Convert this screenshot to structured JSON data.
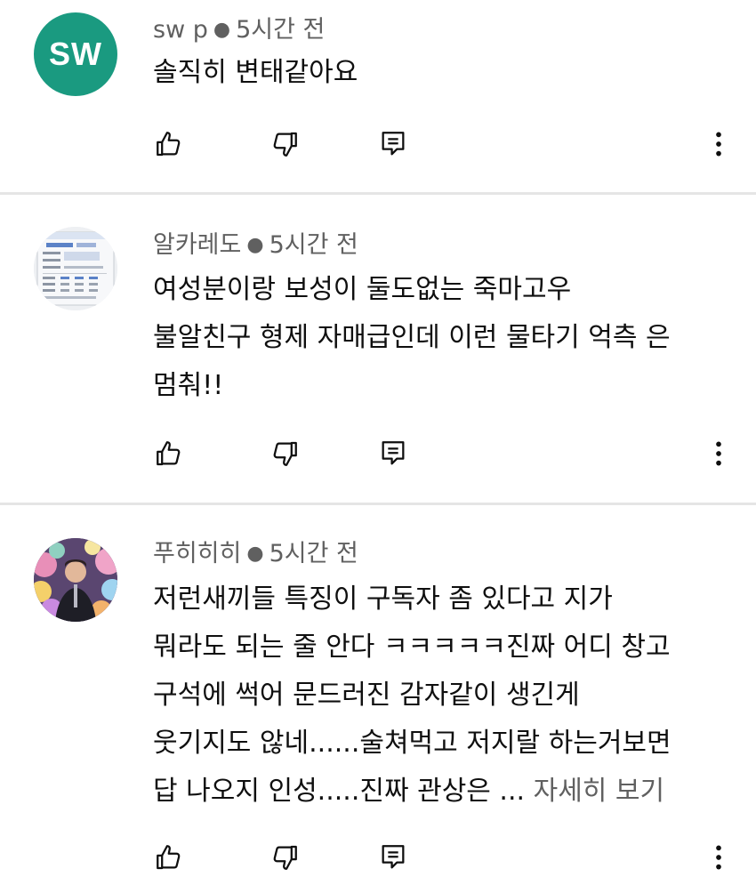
{
  "comments": [
    {
      "author": "sw p",
      "time": "5시간 전",
      "avatar_initials": "SW",
      "avatar_color": "#1a9a80",
      "lines": [
        "솔직히 변태같아요"
      ],
      "read_more": ""
    },
    {
      "author": "알카레도",
      "time": "5시간 전",
      "avatar_kind": "screenshot-thumbnail",
      "lines": [
        "여성분이랑  보성이 둘도없는 죽마고우",
        "불알친구 형제 자매급인데  이런 물타기 억측 은",
        "멈춰!!"
      ],
      "read_more": ""
    },
    {
      "author": "푸히히히",
      "time": "5시간 전",
      "avatar_kind": "photo-person-flowers",
      "lines": [
        "저런새끼들 특징이 구독자 좀 있다고 지가",
        "뭐라도 되는 줄 안다 ㅋㅋㅋㅋㅋ진짜 어디 창고",
        "구석에 썩어 문드러진 감자같이 생긴게",
        "웃기지도 않네......술쳐먹고 저지랄 하는거보면",
        "답 나오지 인성.....진짜 관상은 ..."
      ],
      "read_more": "자세히 보기"
    }
  ],
  "icons": {
    "like": "thumbs-up-icon",
    "dislike": "thumbs-down-icon",
    "reply": "reply-icon",
    "more": "more-vertical-icon"
  },
  "colors": {
    "text": "#0f0f0f",
    "meta": "#606060",
    "divider": "#e5e5e5"
  }
}
